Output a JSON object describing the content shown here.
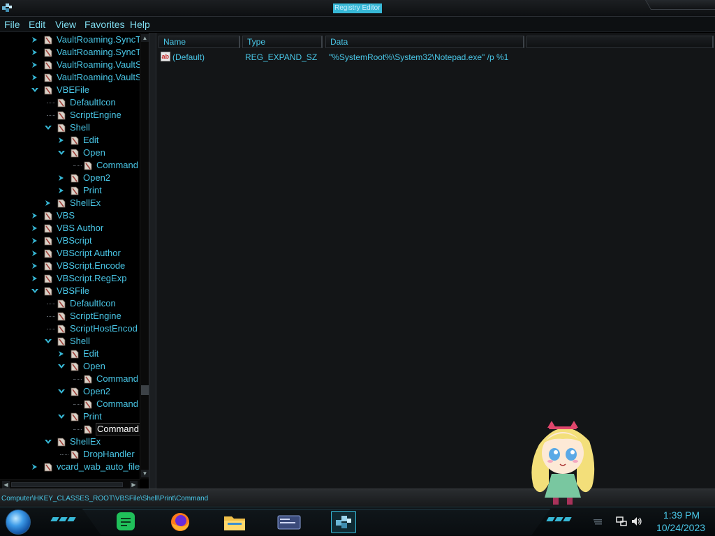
{
  "window": {
    "title": "Registry Editor"
  },
  "menu": [
    "File",
    "Edit",
    "View",
    "Favorites",
    "Help"
  ],
  "tree": {
    "rows": [
      {
        "label": "VaultRoaming.SyncT",
        "level": 0,
        "state": "collapsed"
      },
      {
        "label": "VaultRoaming.SyncT",
        "level": 0,
        "state": "collapsed"
      },
      {
        "label": "VaultRoaming.VaultS",
        "level": 0,
        "state": "collapsed"
      },
      {
        "label": "VaultRoaming.VaultS",
        "level": 0,
        "state": "collapsed"
      },
      {
        "label": "VBEFile",
        "level": 0,
        "state": "expanded"
      },
      {
        "label": "DefaultIcon",
        "level": 1,
        "state": "leaf"
      },
      {
        "label": "ScriptEngine",
        "level": 1,
        "state": "leaf"
      },
      {
        "label": "Shell",
        "level": 1,
        "state": "expanded"
      },
      {
        "label": "Edit",
        "level": 2,
        "state": "collapsed"
      },
      {
        "label": "Open",
        "level": 2,
        "state": "expanded"
      },
      {
        "label": "Command",
        "level": 3,
        "state": "leaf"
      },
      {
        "label": "Open2",
        "level": 2,
        "state": "collapsed"
      },
      {
        "label": "Print",
        "level": 2,
        "state": "collapsed"
      },
      {
        "label": "ShellEx",
        "level": 1,
        "state": "collapsed"
      },
      {
        "label": "VBS",
        "level": 0,
        "state": "collapsed"
      },
      {
        "label": "VBS Author",
        "level": 0,
        "state": "collapsed"
      },
      {
        "label": "VBScript",
        "level": 0,
        "state": "collapsed"
      },
      {
        "label": "VBScript Author",
        "level": 0,
        "state": "collapsed"
      },
      {
        "label": "VBScript.Encode",
        "level": 0,
        "state": "collapsed"
      },
      {
        "label": "VBScript.RegExp",
        "level": 0,
        "state": "collapsed"
      },
      {
        "label": "VBSFile",
        "level": 0,
        "state": "expanded"
      },
      {
        "label": "DefaultIcon",
        "level": 1,
        "state": "leaf"
      },
      {
        "label": "ScriptEngine",
        "level": 1,
        "state": "leaf"
      },
      {
        "label": "ScriptHostEncod",
        "level": 1,
        "state": "leaf"
      },
      {
        "label": "Shell",
        "level": 1,
        "state": "expanded"
      },
      {
        "label": "Edit",
        "level": 2,
        "state": "collapsed"
      },
      {
        "label": "Open",
        "level": 2,
        "state": "expanded"
      },
      {
        "label": "Command",
        "level": 3,
        "state": "leaf"
      },
      {
        "label": "Open2",
        "level": 2,
        "state": "expanded"
      },
      {
        "label": "Command",
        "level": 3,
        "state": "leaf"
      },
      {
        "label": "Print",
        "level": 2,
        "state": "expanded"
      },
      {
        "label": "Command",
        "level": 3,
        "state": "leaf",
        "selected": true
      },
      {
        "label": "ShellEx",
        "level": 1,
        "state": "expanded"
      },
      {
        "label": "DropHandler",
        "level": 2,
        "state": "leaf"
      },
      {
        "label": "vcard_wab_auto_file",
        "level": 0,
        "state": "collapsed"
      }
    ]
  },
  "list": {
    "columns": [
      "Name",
      "Type",
      "Data"
    ],
    "rows": [
      {
        "name": "(Default)",
        "type": "REG_EXPAND_SZ",
        "data": "\"%SystemRoot%\\System32\\Notepad.exe\" /p %1"
      }
    ]
  },
  "status": {
    "path": "Computer\\HKEY_CLASSES_ROOT\\VBSFile\\Shell\\Print\\Command"
  },
  "taskbar": {
    "apps": [
      {
        "name": "notes-app",
        "icon": "notepad-green-icon"
      },
      {
        "name": "firefox",
        "icon": "firefox-icon"
      },
      {
        "name": "file-explorer",
        "icon": "folder-icon"
      },
      {
        "name": "control-panel",
        "icon": "card-window-icon"
      },
      {
        "name": "registry-editor",
        "icon": "registry-icon",
        "active": true
      }
    ],
    "clock": {
      "time": "1:39 PM",
      "date": "10/24/2023"
    }
  },
  "colors": {
    "accent": "#37b8d6",
    "text": "#49c6e6",
    "background": "#131517"
  }
}
